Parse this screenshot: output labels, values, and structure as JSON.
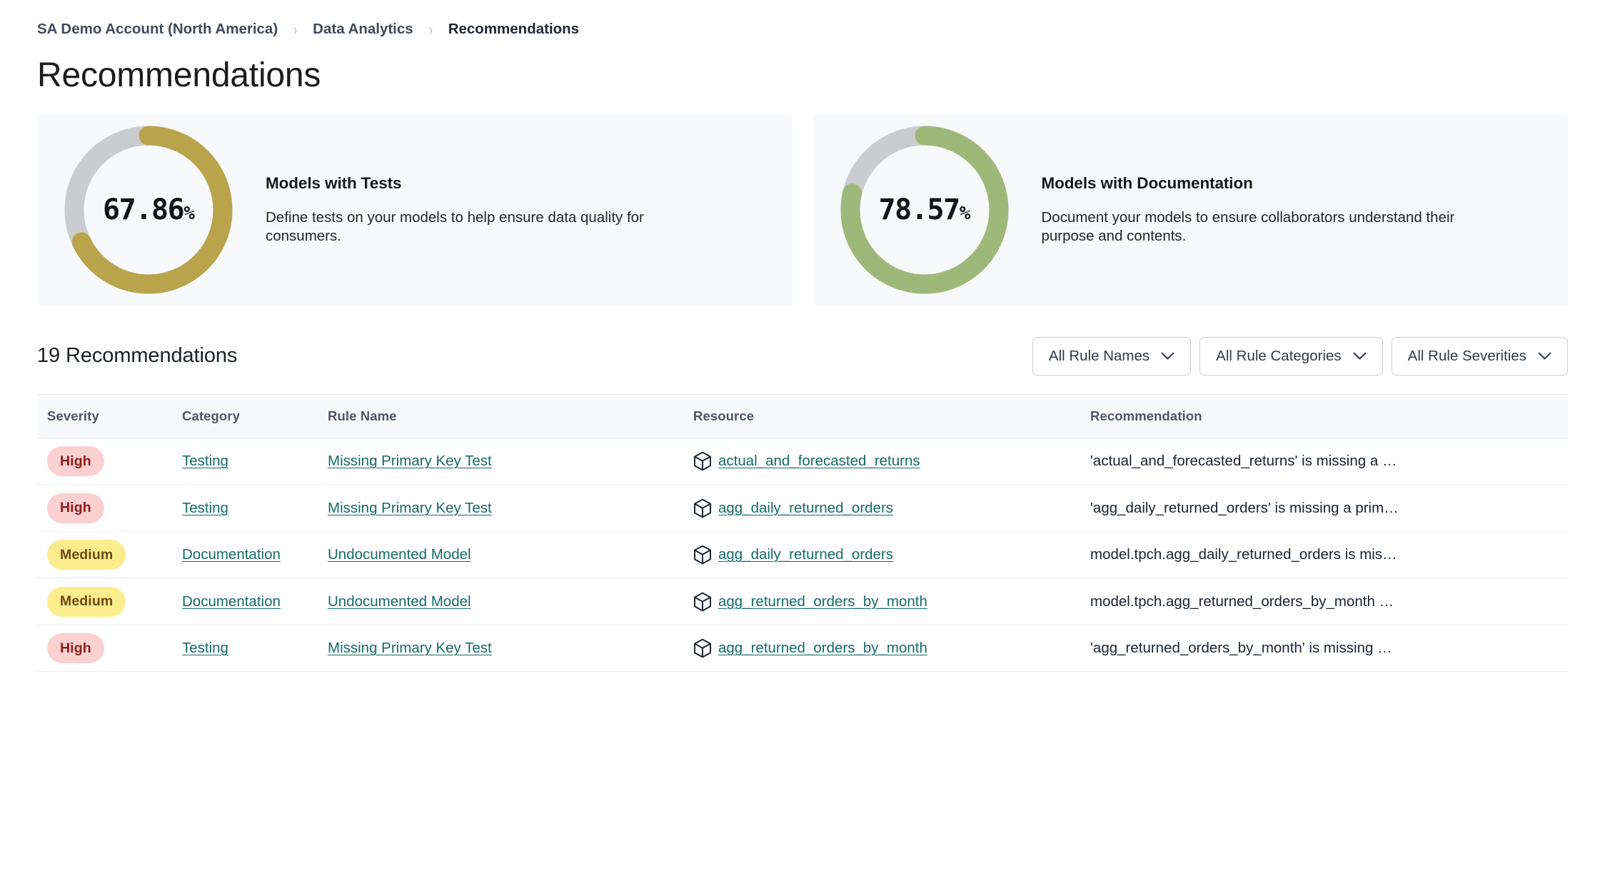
{
  "breadcrumb": {
    "items": [
      {
        "label": "SA Demo Account (North America)",
        "current": false
      },
      {
        "label": "Data Analytics",
        "current": false
      },
      {
        "label": "Recommendations",
        "current": true
      }
    ],
    "separator": "›"
  },
  "page": {
    "title": "Recommendations"
  },
  "cards": [
    {
      "value_number": "67.86",
      "value_suffix": "%",
      "percent": 67.86,
      "title": "Models with Tests",
      "description": "Define tests on your models to help ensure data quality for consumers.",
      "arc_color": "#b9a44c",
      "track_color": "#cbcccd"
    },
    {
      "value_number": "78.57",
      "value_suffix": "%",
      "percent": 78.57,
      "title": "Models with Documentation",
      "description": "Document your models to ensure collaborators understand their purpose and contents.",
      "arc_color": "#9eb87a",
      "track_color": "#cbcccd"
    }
  ],
  "toolbar": {
    "count_label": "19 Recommendations",
    "filters": [
      {
        "label": "All Rule Names"
      },
      {
        "label": "All Rule Categories"
      },
      {
        "label": "All Rule Severities"
      }
    ]
  },
  "table": {
    "columns": [
      "Severity",
      "Category",
      "Rule Name",
      "Resource",
      "Recommendation"
    ],
    "rows": [
      {
        "severity": "High",
        "severity_level": "high",
        "category": "Testing",
        "rule_name": "Missing Primary Key Test",
        "resource": "actual_and_forecasted_returns",
        "resource_icon": "cube-icon",
        "recommendation": "'actual_and_forecasted_returns' is missing a …"
      },
      {
        "severity": "High",
        "severity_level": "high",
        "category": "Testing",
        "rule_name": "Missing Primary Key Test",
        "resource": "agg_daily_returned_orders",
        "resource_icon": "cube-icon",
        "recommendation": "'agg_daily_returned_orders' is missing a prim…"
      },
      {
        "severity": "Medium",
        "severity_level": "medium",
        "category": "Documentation",
        "rule_name": "Undocumented Model",
        "resource": "agg_daily_returned_orders",
        "resource_icon": "cube-icon",
        "recommendation": "model.tpch.agg_daily_returned_orders is mis…"
      },
      {
        "severity": "Medium",
        "severity_level": "medium",
        "category": "Documentation",
        "rule_name": "Undocumented Model",
        "resource": "agg_returned_orders_by_month",
        "resource_icon": "cube-icon",
        "recommendation": "model.tpch.agg_returned_orders_by_month …"
      },
      {
        "severity": "High",
        "severity_level": "high",
        "category": "Testing",
        "rule_name": "Missing Primary Key Test",
        "resource": "agg_returned_orders_by_month",
        "resource_icon": "cube-icon",
        "recommendation": "'agg_returned_orders_by_month' is missing …"
      }
    ]
  },
  "colors": {
    "link": "#156a6a",
    "badge_high_bg": "#fbd0d0",
    "badge_high_fg": "#8c1c1c",
    "badge_medium_bg": "#fbec8e",
    "badge_medium_fg": "#6b4b12",
    "card_bg": "#f8f9fb"
  }
}
